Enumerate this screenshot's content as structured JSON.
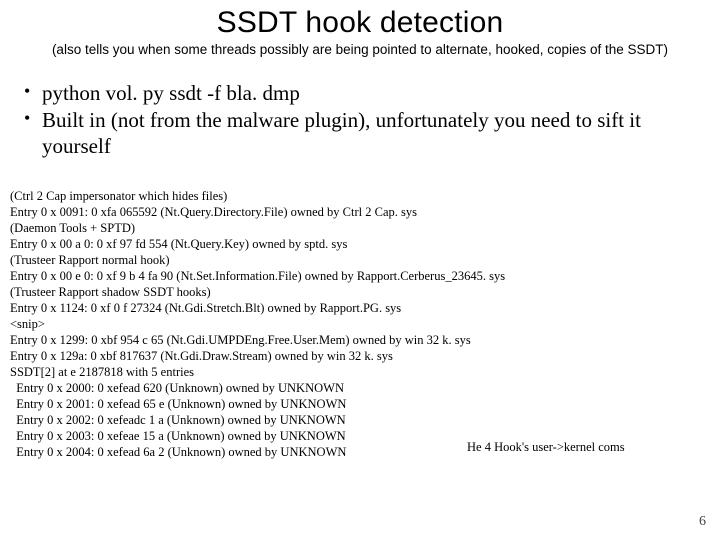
{
  "title": "SSDT hook detection",
  "subtitle": "(also tells you when some threads possibly are being pointed to alternate, hooked, copies of the SSDT)",
  "bullets": [
    "python vol. py ssdt -f bla. dmp",
    "Built in (not from the malware plugin), unfortunately you need to sift it yourself"
  ],
  "code": {
    "l01": "(Ctrl 2 Cap impersonator which hides files)",
    "l02": "Entry 0 x 0091: 0 xfa 065592 (Nt.Query.Directory.File) owned by Ctrl 2 Cap. sys",
    "l03": "(Daemon Tools + SPTD)",
    "l04": "Entry 0 x 00 a 0: 0 xf 97 fd 554 (Nt.Query.Key) owned by sptd. sys",
    "l05": "(Trusteer Rapport normal hook)",
    "l06": "Entry 0 x 00 e 0: 0 xf 9 b 4 fa 90 (Nt.Set.Information.File) owned by Rapport.Cerberus_23645. sys",
    "l07": "(Trusteer Rapport shadow SSDT hooks)",
    "l08": "Entry 0 x 1124: 0 xf 0 f 27324 (Nt.Gdi.Stretch.Blt) owned by Rapport.PG. sys",
    "l09": "<snip>",
    "l10": "Entry 0 x 1299: 0 xbf 954 c 65 (Nt.Gdi.UMPDEng.Free.User.Mem) owned by win 32 k. sys",
    "l11": "Entry 0 x 129a: 0 xbf 817637 (Nt.Gdi.Draw.Stream) owned by win 32 k. sys",
    "l12": "SSDT[2] at e 2187818 with 5 entries",
    "l13": "  Entry 0 x 2000: 0 xefead 620 (Unknown) owned by UNKNOWN",
    "l14": "  Entry 0 x 2001: 0 xefead 65 e (Unknown) owned by UNKNOWN",
    "l15": "  Entry 0 x 2002: 0 xefeadc 1 a (Unknown) owned by UNKNOWN",
    "l16": "  Entry 0 x 2003: 0 xefeae 15 a (Unknown) owned by UNKNOWN",
    "l17": "  Entry 0 x 2004: 0 xefead 6a 2 (Unknown) owned by UNKNOWN"
  },
  "annotation": "He 4 Hook's user->kernel coms",
  "pagenum": "6"
}
